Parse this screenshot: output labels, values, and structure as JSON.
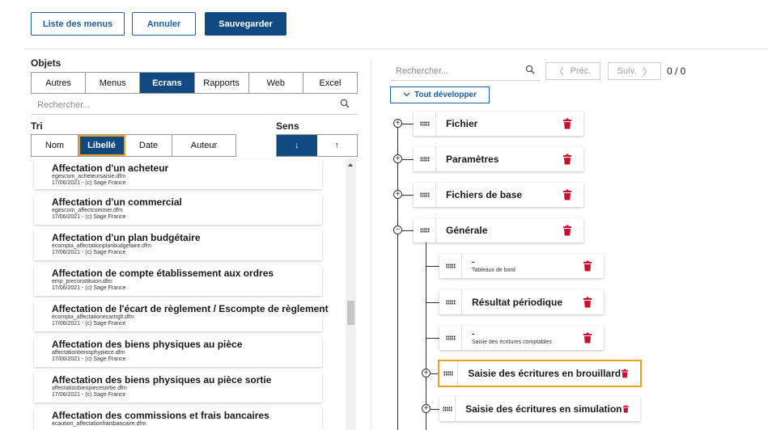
{
  "toolbar": {
    "menu_list": "Liste des menus",
    "cancel": "Annuler",
    "save": "Sauvegarder"
  },
  "objects": {
    "label": "Objets",
    "tabs": [
      "Autres",
      "Menus",
      "Ecrans",
      "Rapports",
      "Web",
      "Excel"
    ],
    "active_tab": "Ecrans",
    "search_placeholder": "Rechercher..."
  },
  "sort": {
    "label": "Tri",
    "options": [
      "Nom",
      "Libellé",
      "Date",
      "Auteur"
    ],
    "active": "Libellé",
    "direction_label": "Sens",
    "directions": [
      "↓",
      "↑"
    ]
  },
  "items": [
    {
      "title": "Affectation d'un acheteur",
      "file": "egescom_acheteursaisie.dfm",
      "date": "17/06/2021 - (c) Sage France"
    },
    {
      "title": "Affectation d'un commercial",
      "file": "egescom_affectcommer.dfm",
      "date": "17/06/2021 - (c) Sage France"
    },
    {
      "title": "Affectation d'un plan budgétaire",
      "file": "ecompta_affectationplanbudgetaire.dfm",
      "date": "17/06/2021 - (c) Sage France"
    },
    {
      "title": "Affectation de compte établissement aux ordres",
      "file": "emp_preconstituion.dfm",
      "date": "17/06/2021 - (c) Sage France"
    },
    {
      "title": "Affectation de l'écart de règlement / Escompte de règlement",
      "file": "ecompta_affectationecartrglt.dfm",
      "date": "17/06/2021 - (c) Sage France"
    },
    {
      "title": "Affectation des biens physiques au pièce",
      "file": "affectationbeinsphypiece.dfm",
      "date": "17/06/2021 - (c) Sage France"
    },
    {
      "title": "Affectation des biens physiques au pièce sortie",
      "file": "affectationbienpiecesortie.dfm",
      "date": "17/06/2021 - (c) Sage France"
    },
    {
      "title": "Affectation des commissions et frais bancaires",
      "file": "ecaution_affectationfraisbancaire.dfm",
      "date": ""
    }
  ],
  "menu": {
    "search_placeholder": "Rechercher...",
    "prev": "Préc.",
    "next": "Suiv.",
    "count": "0 / 0",
    "expand_all": "Tout développer",
    "nodes": [
      {
        "label": "Fichier"
      },
      {
        "label": "Paramètres"
      },
      {
        "label": "Fichiers de base"
      },
      {
        "label": "Générale"
      }
    ],
    "children": [
      {
        "label": "-",
        "sub": "Tableaux de bord"
      },
      {
        "label": "Résultat périodique",
        "sub": ""
      },
      {
        "label": "-",
        "sub": "Saisie des écritures comptables"
      },
      {
        "label": "Saisie des écritures en brouillard",
        "sub": ""
      },
      {
        "label": "Saisie des écritures en simulation",
        "sub": ""
      }
    ]
  },
  "colors": {
    "primary": "#114a80",
    "accent": "#1e5fa4",
    "highlight": "#e6a420",
    "trash": "#c8102e"
  }
}
